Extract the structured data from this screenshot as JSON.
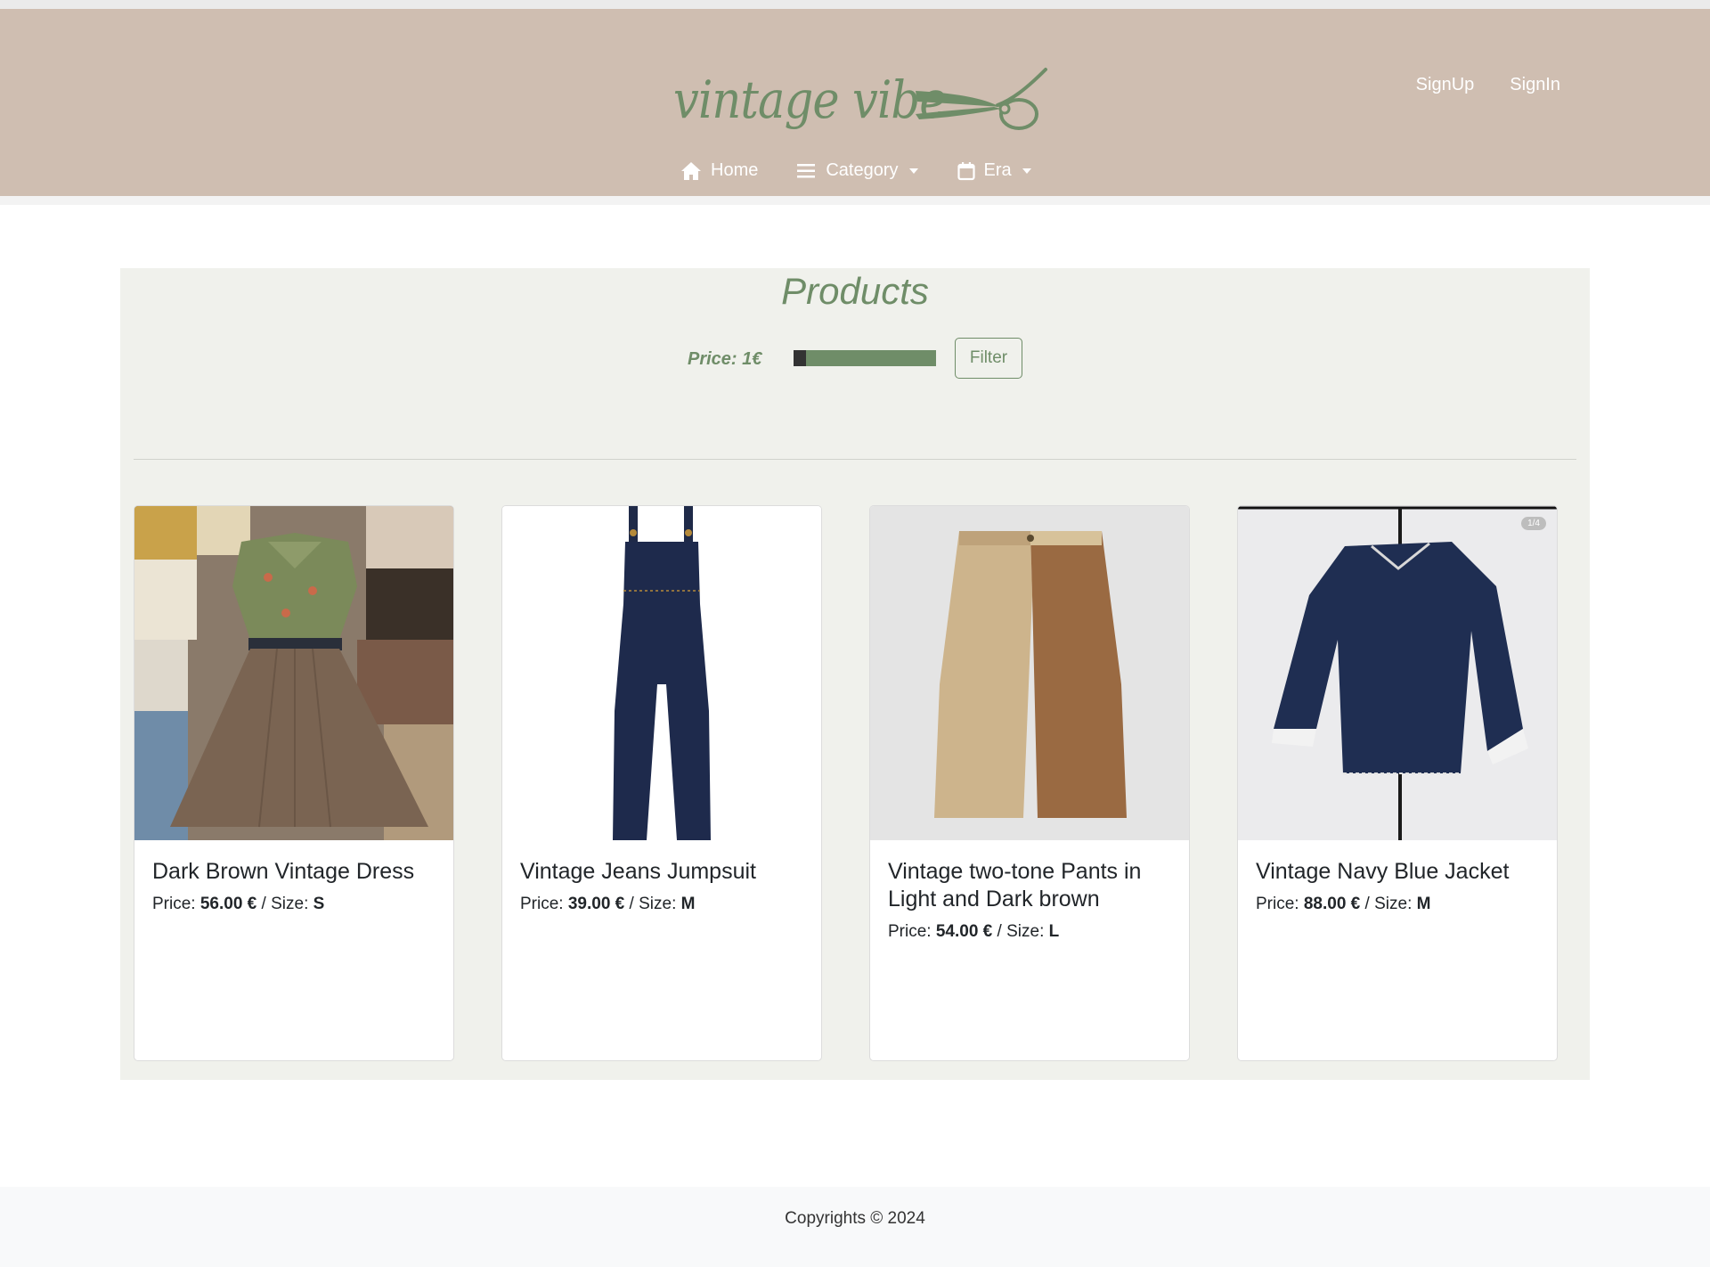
{
  "header": {
    "logo_text": "vintage vibe",
    "auth": {
      "signup": "SignUp",
      "signin": "SignIn"
    },
    "nav": {
      "home": "Home",
      "category": "Category",
      "era": "Era"
    }
  },
  "products": {
    "title": "Products",
    "filter": {
      "price_label": "Price: 1€",
      "price_value_fraction": 0.0,
      "button": "Filter"
    },
    "items": [
      {
        "title": "Dark Brown Vintage Dress",
        "price_label": "Price:",
        "price": "56.00 €",
        "sep": "/ Size:",
        "size": "S"
      },
      {
        "title": "Vintage Jeans Jumpsuit",
        "price_label": "Price:",
        "price": "39.00 €",
        "sep": "/ Size:",
        "size": "M"
      },
      {
        "title": "Vintage two-tone Pants in Light and Dark brown",
        "price_label": "Price:",
        "price": "54.00 €",
        "sep": "/ Size:",
        "size": "L"
      },
      {
        "title": "Vintage Navy Blue Jacket",
        "price_label": "Price:",
        "price": "88.00 €",
        "sep": "/ Size:",
        "size": "M",
        "badge": "1/4"
      }
    ]
  },
  "footer": {
    "text": "Copyrights © 2024"
  },
  "colors": {
    "header_bg": "#cfbeb1",
    "accent": "#6f8d68",
    "panel_bg": "#f0f1ec"
  }
}
